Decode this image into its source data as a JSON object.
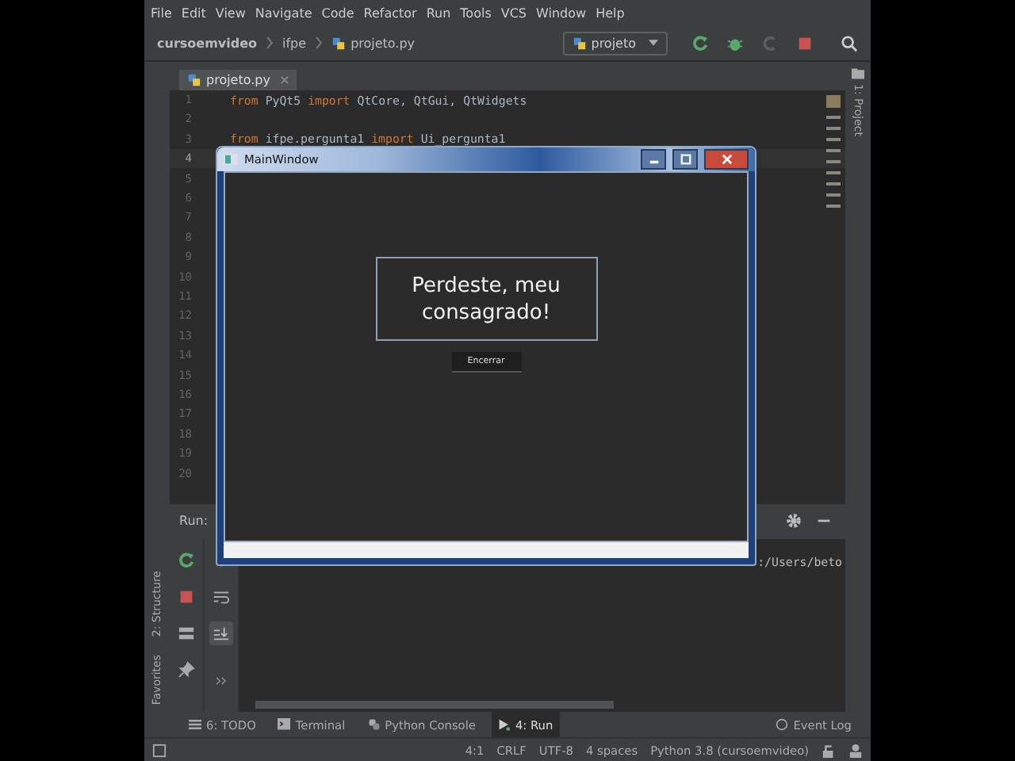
{
  "menu": [
    "File",
    "Edit",
    "View",
    "Navigate",
    "Code",
    "Refactor",
    "Run",
    "Tools",
    "VCS",
    "Window",
    "Help"
  ],
  "breadcrumbs": [
    "cursoemvideo",
    "ifpe",
    "projeto.py"
  ],
  "run_config": "projeto",
  "editor_tabs": [
    {
      "label": "projeto.py",
      "selected": true
    }
  ],
  "editor": {
    "lines": [
      {
        "number": "1",
        "current": false,
        "code": [
          {
            "kind": "keyword",
            "text": "from"
          },
          {
            "kind": "name",
            "text": "PyQt5"
          },
          {
            "kind": "keyword",
            "text": "import"
          },
          {
            "kind": "name",
            "text": "QtCore,"
          },
          {
            "kind": "name",
            "text": "QtGui,"
          },
          {
            "kind": "name",
            "text": "QtWidgets"
          }
        ]
      },
      {
        "number": "2",
        "current": false
      },
      {
        "number": "3",
        "current": false,
        "code": [
          {
            "kind": "keyword",
            "text": "from"
          },
          {
            "kind": "name",
            "text": "ifpe.pergunta1"
          },
          {
            "kind": "keyword",
            "text": "import"
          },
          {
            "kind": "name",
            "text": "Ui_pergunta1"
          }
        ]
      },
      {
        "number": "4",
        "current": true
      },
      {
        "number": "5",
        "current": false
      },
      {
        "number": "6",
        "current": false
      },
      {
        "number": "7",
        "current": false
      },
      {
        "number": "8",
        "current": false
      },
      {
        "number": "9",
        "current": false
      },
      {
        "number": "10",
        "current": false
      },
      {
        "number": "11",
        "current": false
      },
      {
        "number": "12",
        "current": false
      },
      {
        "number": "13",
        "current": false
      },
      {
        "number": "14",
        "current": false
      },
      {
        "number": "15",
        "current": false
      },
      {
        "number": "16",
        "current": false
      },
      {
        "number": "17",
        "current": false
      },
      {
        "number": "18",
        "current": false
      },
      {
        "number": "19",
        "current": false
      },
      {
        "number": "20",
        "current": false
      }
    ]
  },
  "right_stripe": {
    "label": "1: Project"
  },
  "left_stripe": [
    "2: Structure",
    "Favorites"
  ],
  "run_panel": {
    "label": "Run:",
    "output": ":/Users/beto"
  },
  "bottom_tabs": [
    {
      "label": "6: TODO",
      "kind": "list",
      "selected": false
    },
    {
      "label": "Terminal",
      "kind": "terminal",
      "selected": false
    },
    {
      "label": "Python Console",
      "kind": "python",
      "selected": false
    },
    {
      "label": "4: Run",
      "kind": "run",
      "selected": true
    }
  ],
  "event_log": "Event Log",
  "status": [
    "4:1",
    "CRLF",
    "UTF-8",
    "4 spaces",
    "Python 3.8 (cursoemvideo)"
  ],
  "dialog": {
    "title": "MainWindow",
    "message": "Perdeste, meu consagrado!",
    "button": "Encerrar"
  }
}
